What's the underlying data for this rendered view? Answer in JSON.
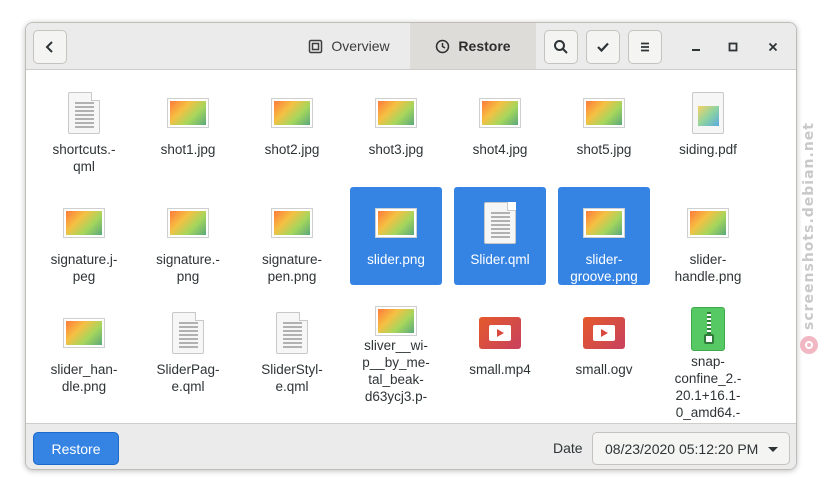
{
  "header": {
    "tabs": [
      {
        "label": "Overview",
        "icon": "overview-icon",
        "active": false
      },
      {
        "label": "Restore",
        "icon": "history-clock-icon",
        "active": true
      }
    ],
    "buttons": {
      "back": "back-arrow-icon",
      "search": "search-icon",
      "select": "checkmark-icon",
      "menu": "hamburger-menu-icon",
      "minimize": "minimize-icon",
      "maximize": "maximize-icon",
      "close": "close-icon"
    }
  },
  "files": [
    {
      "name": "shortcuts.-\nqml",
      "type": "text"
    },
    {
      "name": "shot1.jpg",
      "type": "image"
    },
    {
      "name": "shot2.jpg",
      "type": "image"
    },
    {
      "name": "shot3.jpg",
      "type": "image"
    },
    {
      "name": "shot4.jpg",
      "type": "image"
    },
    {
      "name": "shot5.jpg",
      "type": "image"
    },
    {
      "name": "siding.pdf",
      "type": "pdf"
    },
    {
      "name": "signature.j-\npeg",
      "type": "image"
    },
    {
      "name": "signature.-\npng",
      "type": "image"
    },
    {
      "name": "signature-\npen.png",
      "type": "image"
    },
    {
      "name": "slider.png",
      "type": "image",
      "selected": true
    },
    {
      "name": "Slider.qml",
      "type": "text",
      "selected": true
    },
    {
      "name": "slider-\ngroove.png",
      "type": "image",
      "selected": true
    },
    {
      "name": "slider-\nhandle.png",
      "type": "image"
    },
    {
      "name": "slider_han-\ndle.png",
      "type": "image"
    },
    {
      "name": "SliderPag-\ne.qml",
      "type": "text"
    },
    {
      "name": "SliderStyl-\ne.qml",
      "type": "text"
    },
    {
      "name": "sliver__wi-\np__by_me-\ntal_beak-\nd63ycj3.p-",
      "type": "image"
    },
    {
      "name": "small.mp4",
      "type": "video"
    },
    {
      "name": "small.ogv",
      "type": "video"
    },
    {
      "name": "snap-\nconfine_2.-\n20.1+16.1-\n0_amd64.-",
      "type": "archive"
    }
  ],
  "footer": {
    "restore_label": "Restore",
    "date_label": "Date",
    "date_value": "08/23/2020 05:12:20 PM"
  },
  "watermark": "screenshots.debian.net",
  "colors": {
    "accent": "#3584e4",
    "header_bg": "#ebebeb"
  }
}
